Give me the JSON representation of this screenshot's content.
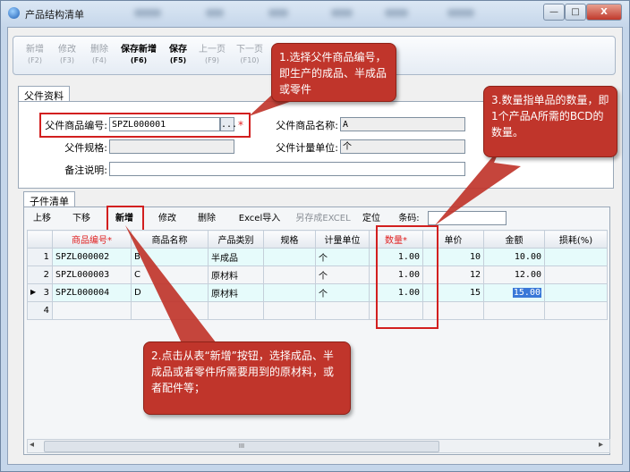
{
  "window": {
    "title": "产品结构清单",
    "buttons": {
      "minimize": "—",
      "maximize": "□",
      "close": "X"
    }
  },
  "toolbar": [
    {
      "label": "新增",
      "key": "(F2)",
      "enabled": false
    },
    {
      "label": "修改",
      "key": "(F3)",
      "enabled": false
    },
    {
      "label": "删除",
      "key": "(F4)",
      "enabled": false
    },
    {
      "label": "保存新增",
      "key": "(F6)",
      "enabled": true
    },
    {
      "label": "保存",
      "key": "(F5)",
      "enabled": true
    },
    {
      "label": "上一页",
      "key": "(F9)",
      "enabled": false
    },
    {
      "label": "下一页",
      "key": "(F10)",
      "enabled": false
    }
  ],
  "parent_tab": "父件资料",
  "parent": {
    "code_label": "父件商品编号:",
    "code_value": "SPZL000001",
    "browse": "...",
    "required_mark": "*",
    "name_label": "父件商品名称:",
    "name_value": "A",
    "spec_label": "父件规格:",
    "spec_value": "",
    "unit_label": "父件计量单位:",
    "unit_value": "个",
    "remark_label": "备注说明:",
    "remark_value": ""
  },
  "child_tab": "子件清单",
  "child_toolbar": {
    "up": "上移",
    "down": "下移",
    "add": "新增",
    "edit": "修改",
    "delete": "删除",
    "excel_import": "Excel导入",
    "save_excel": "另存成EXCEL",
    "locate": "定位",
    "barcode_label": "条码:",
    "barcode_value": ""
  },
  "grid": {
    "columns": [
      "",
      "商品编号*",
      "商品名称",
      "产品类别",
      "规格",
      "计量单位",
      "数量*",
      "单价",
      "金额",
      "损耗(%)"
    ],
    "rows": [
      {
        "n": "1",
        "code": "SPZL000002",
        "name": "B",
        "category": "半成品",
        "spec": "",
        "unit": "个",
        "qty": "1.00",
        "price": "10",
        "amount": "10.00",
        "loss": ""
      },
      {
        "n": "2",
        "code": "SPZL000003",
        "name": "C",
        "category": "原材料",
        "spec": "",
        "unit": "个",
        "qty": "1.00",
        "price": "12",
        "amount": "12.00",
        "loss": ""
      },
      {
        "n": "3",
        "code": "SPZL000004",
        "name": "D",
        "category": "原材料",
        "spec": "",
        "unit": "个",
        "qty": "1.00",
        "price": "15",
        "amount": "15.00",
        "loss": ""
      },
      {
        "n": "4",
        "code": "",
        "name": "",
        "category": "",
        "spec": "",
        "unit": "",
        "qty": "",
        "price": "",
        "amount": "",
        "loss": ""
      }
    ],
    "current_row_marker": "▶"
  },
  "callouts": {
    "c1": "1.选择父件商品编号，即生产的成品、半成品或零件",
    "c2": "2.点击从表“新增”按钮，选择成品、半成品或者零件所需要用到的原材料，或者配件等；",
    "c3": "3.数量指单品的数量，即1个产品A所需的BCD的数量。"
  },
  "scrollbar": {
    "left": "◂",
    "thumb": "III",
    "right": "▸"
  },
  "colors": {
    "callout": "#c0352b",
    "highlight_box": "#d21f1f",
    "selected_row": "#e6fbfb"
  }
}
